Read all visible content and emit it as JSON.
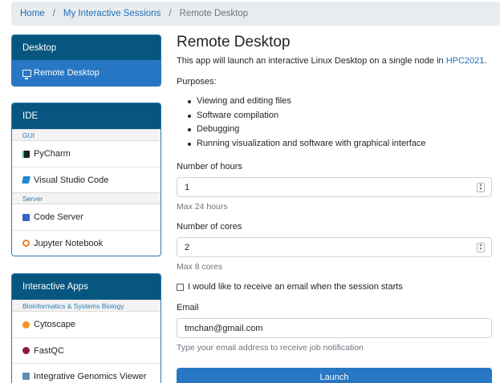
{
  "breadcrumb": {
    "home": "Home",
    "sessions": "My Interactive Sessions",
    "current": "Remote Desktop",
    "separator": "/"
  },
  "sidebar": {
    "desktop": {
      "header": "Desktop",
      "items": [
        {
          "label": "Remote Desktop",
          "icon": "monitor-icon"
        }
      ]
    },
    "ide": {
      "header": "IDE",
      "groups": [
        {
          "label": "GUI",
          "items": [
            {
              "label": "PyCharm",
              "icon": "pycharm-icon"
            },
            {
              "label": "Visual Studio Code",
              "icon": "vscode-icon"
            }
          ]
        },
        {
          "label": "Server",
          "items": [
            {
              "label": "Code Server",
              "icon": "code-server-icon"
            },
            {
              "label": "Jupyter Notebook",
              "icon": "jupyter-icon"
            }
          ]
        }
      ]
    },
    "apps": {
      "header": "Interactive Apps",
      "group": "Bioinformatics & Systems Biology",
      "items": [
        {
          "label": "Cytoscape",
          "icon": "cytoscape-icon"
        },
        {
          "label": "FastQC",
          "icon": "fastqc-icon"
        },
        {
          "label": "Integrative Genomics Viewer",
          "icon": "igv-icon"
        }
      ]
    }
  },
  "main": {
    "title": "Remote Desktop",
    "intro_text": "This app will launch an interactive Linux Desktop on a single node in ",
    "intro_link": "HPC2021",
    "intro_end": ".",
    "purposes_title": "Purposes:",
    "purposes": [
      "Viewing and editing files",
      "Software compilation",
      "Debugging",
      "Running visualization and software with graphical interface"
    ],
    "hours": {
      "label": "Number of hours",
      "value": "1",
      "help": "Max 24 hours"
    },
    "cores": {
      "label": "Number of cores",
      "value": "2",
      "help": "Max 8 cores"
    },
    "email_notify": {
      "label": "I would like to receive an email when the session starts",
      "checked": false
    },
    "email": {
      "label": "Email",
      "value": "tmchan@gmail.com",
      "help": "Type your email address to receive job notification"
    },
    "launch_label": "Launch"
  },
  "colors": {
    "panel_header": "#07567f",
    "active_item": "#2777c4",
    "link": "#1f6fb8",
    "launch_button": "#2777c4"
  }
}
